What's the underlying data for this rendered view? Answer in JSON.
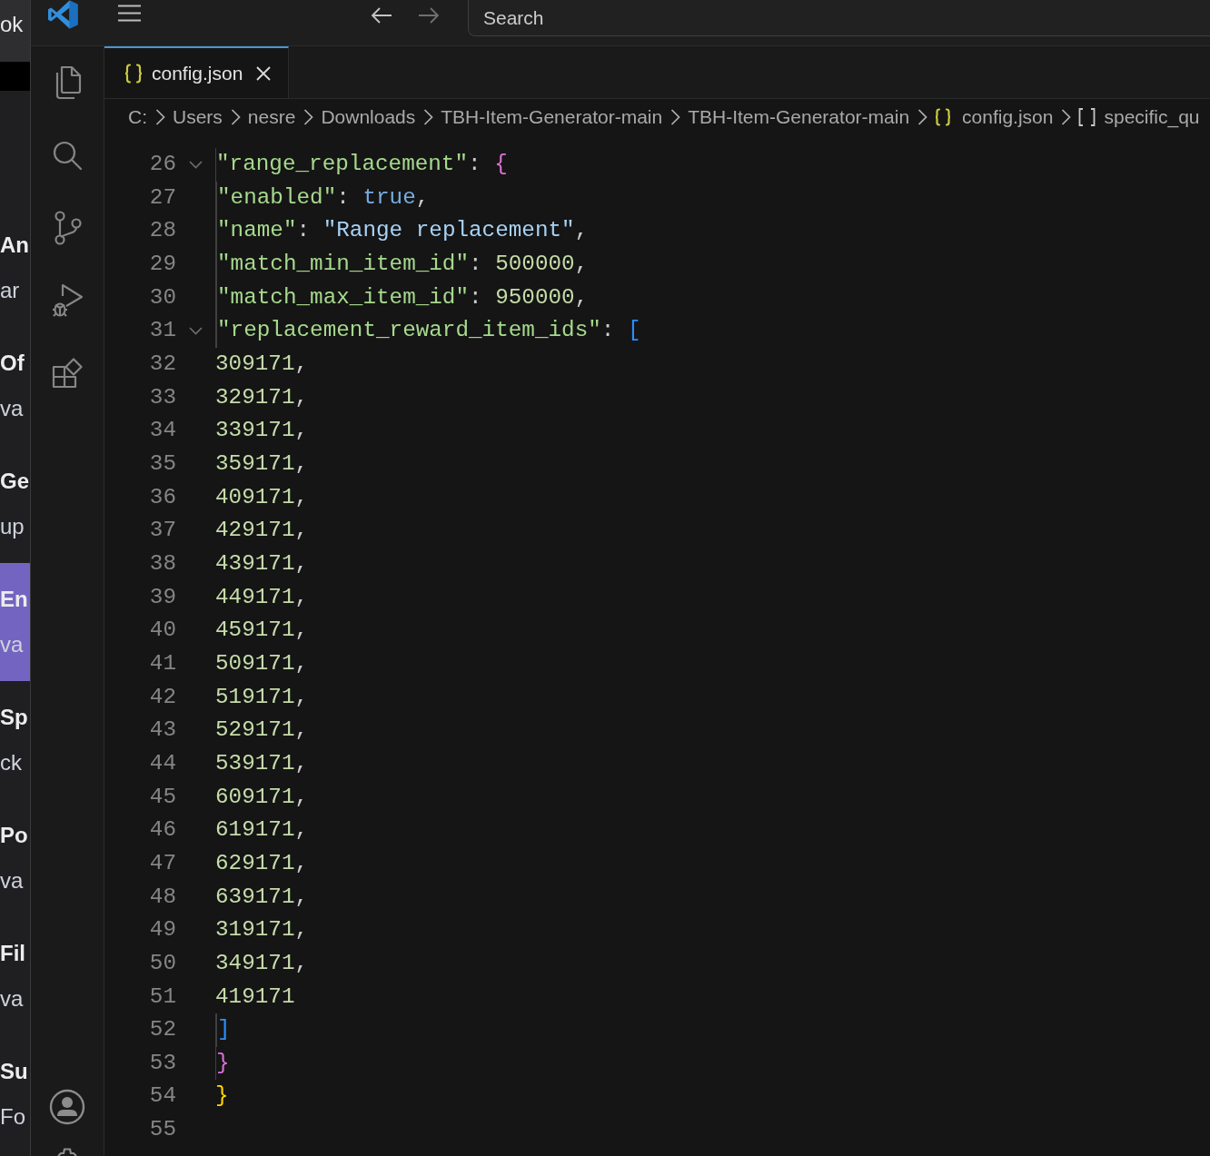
{
  "background_window": {
    "header": "ok",
    "entries": [
      {
        "title": "An",
        "subtitle": "ar",
        "selected": false
      },
      {
        "title": "Of",
        "subtitle": "va",
        "selected": false
      },
      {
        "title": "Ge",
        "subtitle": "up",
        "selected": false
      },
      {
        "title": "En",
        "subtitle": "va",
        "selected": true
      },
      {
        "title": "Sp",
        "subtitle": "ck",
        "selected": false
      },
      {
        "title": "Po",
        "subtitle": "va",
        "selected": false
      },
      {
        "title": "Fil",
        "subtitle": "va",
        "selected": false
      },
      {
        "title": "Su",
        "subtitle": "Fo",
        "selected": false
      }
    ]
  },
  "title_bar": {
    "nav": [
      {
        "kind": "back",
        "disabled": false
      },
      {
        "kind": "forward",
        "disabled": true
      }
    ],
    "search": {
      "placeholder": "Search"
    }
  },
  "activity_bar": {
    "items": [
      {
        "kind": "explorer"
      },
      {
        "kind": "search"
      },
      {
        "kind": "source-control"
      },
      {
        "kind": "run-debug"
      },
      {
        "kind": "extensions"
      }
    ],
    "bottom": [
      {
        "kind": "account"
      },
      {
        "kind": "settings"
      }
    ]
  },
  "tabs": [
    {
      "label": "config.json",
      "kind": "json",
      "selected": true
    }
  ],
  "breadcrumbs": [
    {
      "text": "C:",
      "kind": "folder"
    },
    {
      "text": "Users",
      "kind": "folder"
    },
    {
      "text": "nesre",
      "kind": "folder"
    },
    {
      "text": "Downloads",
      "kind": "folder"
    },
    {
      "text": "TBH-Item-Generator-main",
      "kind": "folder"
    },
    {
      "text": "TBH-Item-Generator-main",
      "kind": "folder"
    },
    {
      "text": "config.json",
      "kind": "json-file"
    },
    {
      "text": "specific_qu",
      "kind": "array"
    }
  ],
  "editor": {
    "lines": [
      {
        "number": "26",
        "foldable": true,
        "tokens": [
          {
            "kind": "key",
            "text": "  \"range_replacement\""
          },
          {
            "kind": "punct",
            "text": ": "
          },
          {
            "kind": "bracket",
            "text": "{",
            "color": "#da70d6"
          }
        ]
      },
      {
        "number": "27",
        "foldable": false,
        "tokens": [
          {
            "kind": "key",
            "text": "    \"enabled\""
          },
          {
            "kind": "punct",
            "text": ": "
          },
          {
            "kind": "boolean",
            "text": "true"
          },
          {
            "kind": "punct",
            "text": ","
          }
        ]
      },
      {
        "number": "28",
        "foldable": false,
        "tokens": [
          {
            "kind": "key",
            "text": "    \"name\""
          },
          {
            "kind": "punct",
            "text": ": "
          },
          {
            "kind": "string",
            "text": "\"Range replacement\""
          },
          {
            "kind": "punct",
            "text": ","
          }
        ]
      },
      {
        "number": "29",
        "foldable": false,
        "tokens": [
          {
            "kind": "key",
            "text": "    \"match_min_item_id\""
          },
          {
            "kind": "punct",
            "text": ": "
          },
          {
            "kind": "number",
            "text": "500000"
          },
          {
            "kind": "punct",
            "text": ","
          }
        ]
      },
      {
        "number": "30",
        "foldable": false,
        "tokens": [
          {
            "kind": "key",
            "text": "    \"match_max_item_id\""
          },
          {
            "kind": "punct",
            "text": ": "
          },
          {
            "kind": "number",
            "text": "950000"
          },
          {
            "kind": "punct",
            "text": ","
          }
        ]
      },
      {
        "number": "31",
        "foldable": true,
        "tokens": [
          {
            "kind": "key",
            "text": "    \"replacement_reward_item_ids\""
          },
          {
            "kind": "punct",
            "text": ": "
          },
          {
            "kind": "bracket",
            "text": "[",
            "color": "#2a8fff"
          }
        ]
      },
      {
        "number": "32",
        "foldable": false,
        "tokens": [
          {
            "kind": "number",
            "text": "309171"
          },
          {
            "kind": "punct",
            "text": ","
          }
        ]
      },
      {
        "number": "33",
        "foldable": false,
        "tokens": [
          {
            "kind": "number",
            "text": "329171"
          },
          {
            "kind": "punct",
            "text": ","
          }
        ]
      },
      {
        "number": "34",
        "foldable": false,
        "tokens": [
          {
            "kind": "number",
            "text": "339171"
          },
          {
            "kind": "punct",
            "text": ","
          }
        ]
      },
      {
        "number": "35",
        "foldable": false,
        "tokens": [
          {
            "kind": "number",
            "text": "359171"
          },
          {
            "kind": "punct",
            "text": ","
          }
        ]
      },
      {
        "number": "36",
        "foldable": false,
        "tokens": [
          {
            "kind": "number",
            "text": "409171"
          },
          {
            "kind": "punct",
            "text": ","
          }
        ]
      },
      {
        "number": "37",
        "foldable": false,
        "tokens": [
          {
            "kind": "number",
            "text": "429171"
          },
          {
            "kind": "punct",
            "text": ","
          }
        ]
      },
      {
        "number": "38",
        "foldable": false,
        "tokens": [
          {
            "kind": "number",
            "text": "439171"
          },
          {
            "kind": "punct",
            "text": ","
          }
        ]
      },
      {
        "number": "39",
        "foldable": false,
        "tokens": [
          {
            "kind": "number",
            "text": "449171"
          },
          {
            "kind": "punct",
            "text": ","
          }
        ]
      },
      {
        "number": "40",
        "foldable": false,
        "tokens": [
          {
            "kind": "number",
            "text": "459171"
          },
          {
            "kind": "punct",
            "text": ","
          }
        ]
      },
      {
        "number": "41",
        "foldable": false,
        "tokens": [
          {
            "kind": "number",
            "text": "509171"
          },
          {
            "kind": "punct",
            "text": ","
          }
        ]
      },
      {
        "number": "42",
        "foldable": false,
        "tokens": [
          {
            "kind": "number",
            "text": "519171"
          },
          {
            "kind": "punct",
            "text": ","
          }
        ]
      },
      {
        "number": "43",
        "foldable": false,
        "tokens": [
          {
            "kind": "number",
            "text": "529171"
          },
          {
            "kind": "punct",
            "text": ","
          }
        ]
      },
      {
        "number": "44",
        "foldable": false,
        "tokens": [
          {
            "kind": "number",
            "text": "539171"
          },
          {
            "kind": "punct",
            "text": ","
          }
        ]
      },
      {
        "number": "45",
        "foldable": false,
        "tokens": [
          {
            "kind": "number",
            "text": "609171"
          },
          {
            "kind": "punct",
            "text": ","
          }
        ]
      },
      {
        "number": "46",
        "foldable": false,
        "tokens": [
          {
            "kind": "number",
            "text": "619171"
          },
          {
            "kind": "punct",
            "text": ","
          }
        ]
      },
      {
        "number": "47",
        "foldable": false,
        "tokens": [
          {
            "kind": "number",
            "text": "629171"
          },
          {
            "kind": "punct",
            "text": ","
          }
        ]
      },
      {
        "number": "48",
        "foldable": false,
        "tokens": [
          {
            "kind": "number",
            "text": "639171"
          },
          {
            "kind": "punct",
            "text": ","
          }
        ]
      },
      {
        "number": "49",
        "foldable": false,
        "tokens": [
          {
            "kind": "number",
            "text": "319171"
          },
          {
            "kind": "punct",
            "text": ","
          }
        ]
      },
      {
        "number": "50",
        "foldable": false,
        "tokens": [
          {
            "kind": "number",
            "text": "349171"
          },
          {
            "kind": "punct",
            "text": ","
          }
        ]
      },
      {
        "number": "51",
        "foldable": false,
        "tokens": [
          {
            "kind": "number",
            "text": "419171"
          }
        ]
      },
      {
        "number": "52",
        "foldable": false,
        "tokens": [
          {
            "kind": "bracket",
            "text": "    ]",
            "color": "#2a8fff"
          }
        ]
      },
      {
        "number": "53",
        "foldable": false,
        "tokens": [
          {
            "kind": "bracket",
            "text": "  }",
            "color": "#da70d6"
          }
        ]
      },
      {
        "number": "54",
        "foldable": false,
        "tokens": [
          {
            "kind": "bracket",
            "text": "}",
            "color": "#ffd700"
          }
        ]
      },
      {
        "number": "55",
        "foldable": false
      }
    ]
  }
}
